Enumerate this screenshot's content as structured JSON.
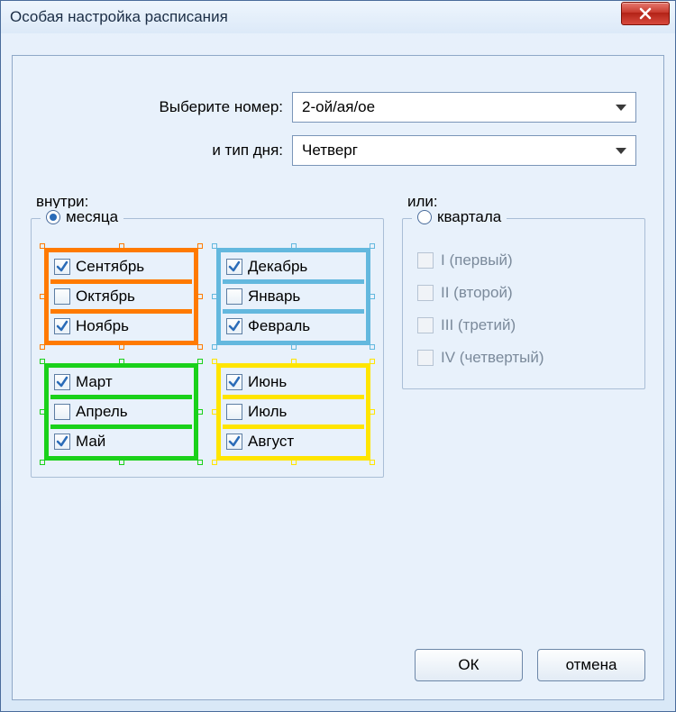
{
  "title": "Особая настройка расписания",
  "selects": {
    "number_label": "Выберите номер:",
    "number_value": "2-ой/ая/ое",
    "daytype_label": "и тип дня:",
    "daytype_value": "Четверг"
  },
  "panels": {
    "inside_label": "внутри:",
    "or_label": "или:",
    "month_radio": "месяца",
    "quarter_radio": "квартала"
  },
  "seasons": [
    {
      "color": "orange",
      "months": [
        {
          "label": "Сентябрь",
          "checked": true
        },
        {
          "label": "Октябрь",
          "checked": false
        },
        {
          "label": "Ноябрь",
          "checked": true
        }
      ]
    },
    {
      "color": "blue",
      "months": [
        {
          "label": "Декабрь",
          "checked": true
        },
        {
          "label": "Январь",
          "checked": false
        },
        {
          "label": "Февраль",
          "checked": true
        }
      ]
    },
    {
      "color": "green",
      "months": [
        {
          "label": "Март",
          "checked": true
        },
        {
          "label": "Апрель",
          "checked": false
        },
        {
          "label": "Май",
          "checked": true
        }
      ]
    },
    {
      "color": "yellow",
      "months": [
        {
          "label": "Июнь",
          "checked": true
        },
        {
          "label": "Июль",
          "checked": false
        },
        {
          "label": "Август",
          "checked": true
        }
      ]
    }
  ],
  "quarters": [
    {
      "label": "I (первый)"
    },
    {
      "label": "II (второй)"
    },
    {
      "label": "III (третий)"
    },
    {
      "label": "IV (четвертый)"
    }
  ],
  "buttons": {
    "ok": "ОК",
    "cancel": "отмена"
  }
}
